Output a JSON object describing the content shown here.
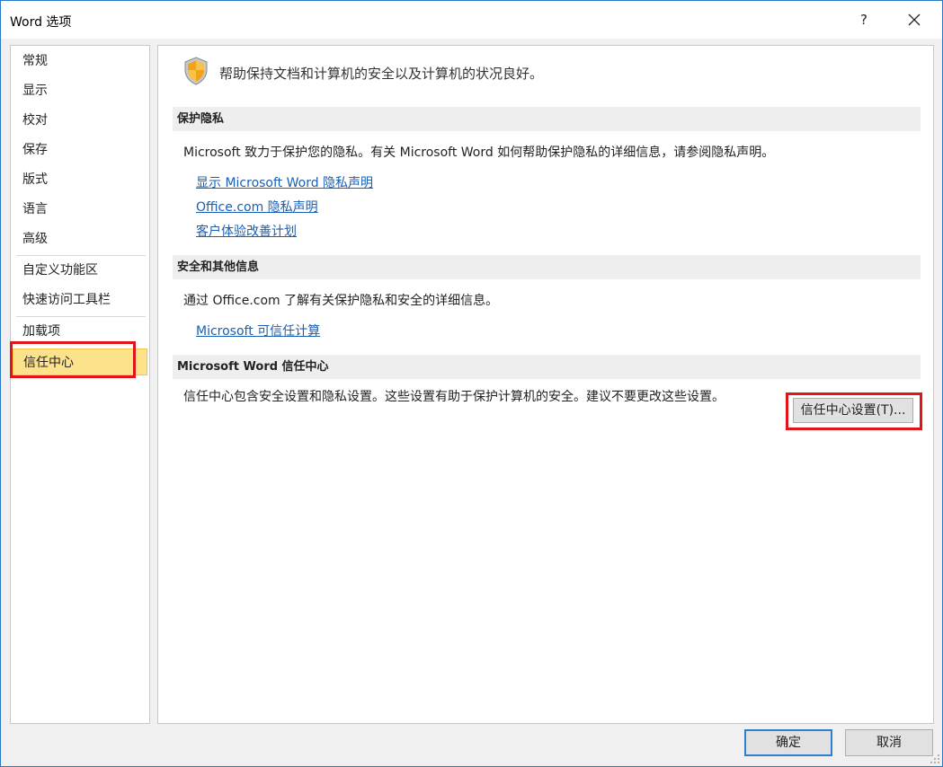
{
  "window": {
    "title": "Word 选项",
    "help_label": "?",
    "close_label": "关闭"
  },
  "sidebar": {
    "items": [
      {
        "label": "常规"
      },
      {
        "label": "显示"
      },
      {
        "label": "校对"
      },
      {
        "label": "保存"
      },
      {
        "label": "版式"
      },
      {
        "label": "语言"
      },
      {
        "label": "高级"
      },
      {
        "label": "自定义功能区"
      },
      {
        "label": "快速访问工具栏"
      },
      {
        "label": "加载项"
      },
      {
        "label": "信任中心"
      }
    ],
    "selected": "信任中心"
  },
  "main": {
    "header": "帮助保持文档和计算机的安全以及计算机的状况良好。",
    "privacy": {
      "title": "保护隐私",
      "text": "Microsoft 致力于保护您的隐私。有关 Microsoft Word 如何帮助保护隐私的详细信息，请参阅隐私声明。",
      "links": [
        "显示 Microsoft Word 隐私声明",
        "Office.com 隐私声明",
        "客户体验改善计划"
      ]
    },
    "security": {
      "title": "安全和其他信息",
      "text": "通过 Office.com 了解有关保护隐私和安全的详细信息。",
      "link": "Microsoft 可信任计算"
    },
    "trust_center": {
      "title": "Microsoft Word 信任中心",
      "text": "信任中心包含安全设置和隐私设置。这些设置有助于保护计算机的安全。建议不要更改这些设置。",
      "button": "信任中心设置(T)..."
    }
  },
  "footer": {
    "ok": "确定",
    "cancel": "取消"
  },
  "colors": {
    "selection": "#fce28a",
    "highlight_frame": "#e0141b",
    "link": "#1a5fb4",
    "window_border": "#2b79c2"
  }
}
